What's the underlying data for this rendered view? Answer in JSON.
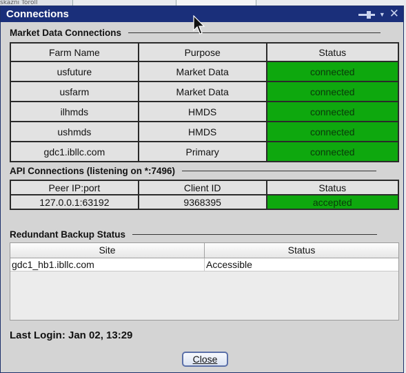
{
  "background": {
    "tab_text": "skazni Toroll"
  },
  "window": {
    "title": "Connections",
    "controls": {
      "pin_icon": "pin-icon",
      "menu_icon": "chevron-down-icon",
      "close_icon": "close-icon",
      "close_glyph": "✕",
      "menu_glyph": "▼"
    }
  },
  "market_data": {
    "title": "Market Data Connections",
    "columns": [
      "Farm Name",
      "Purpose",
      "Status"
    ],
    "rows": [
      {
        "farm": "usfuture",
        "purpose": "Market Data",
        "status": "connected"
      },
      {
        "farm": "usfarm",
        "purpose": "Market Data",
        "status": "connected"
      },
      {
        "farm": "ilhmds",
        "purpose": "HMDS",
        "status": "connected"
      },
      {
        "farm": "ushmds",
        "purpose": "HMDS",
        "status": "connected"
      },
      {
        "farm": "gdc1.ibllc.com",
        "purpose": "Primary",
        "status": "connected"
      }
    ]
  },
  "api": {
    "title": "API Connections (listening on *:7496)",
    "columns": [
      "Peer IP:port",
      "Client ID",
      "Status"
    ],
    "rows": [
      {
        "peer": "127.0.0.1:63192",
        "client_id": "9368395",
        "status": "accepted"
      }
    ]
  },
  "backup": {
    "title": "Redundant Backup Status",
    "columns": [
      "Site",
      "Status"
    ],
    "rows": [
      {
        "site": "gdc1_hb1.ibllc.com",
        "status": "Accessible"
      }
    ]
  },
  "last_login": "Last Login: Jan 02, 13:29",
  "close_button": {
    "label": "Close"
  },
  "colors": {
    "title_bar": "#1a2f7a",
    "ok_green": "#0ea80e",
    "dialog_bg": "#d4d4d4"
  }
}
